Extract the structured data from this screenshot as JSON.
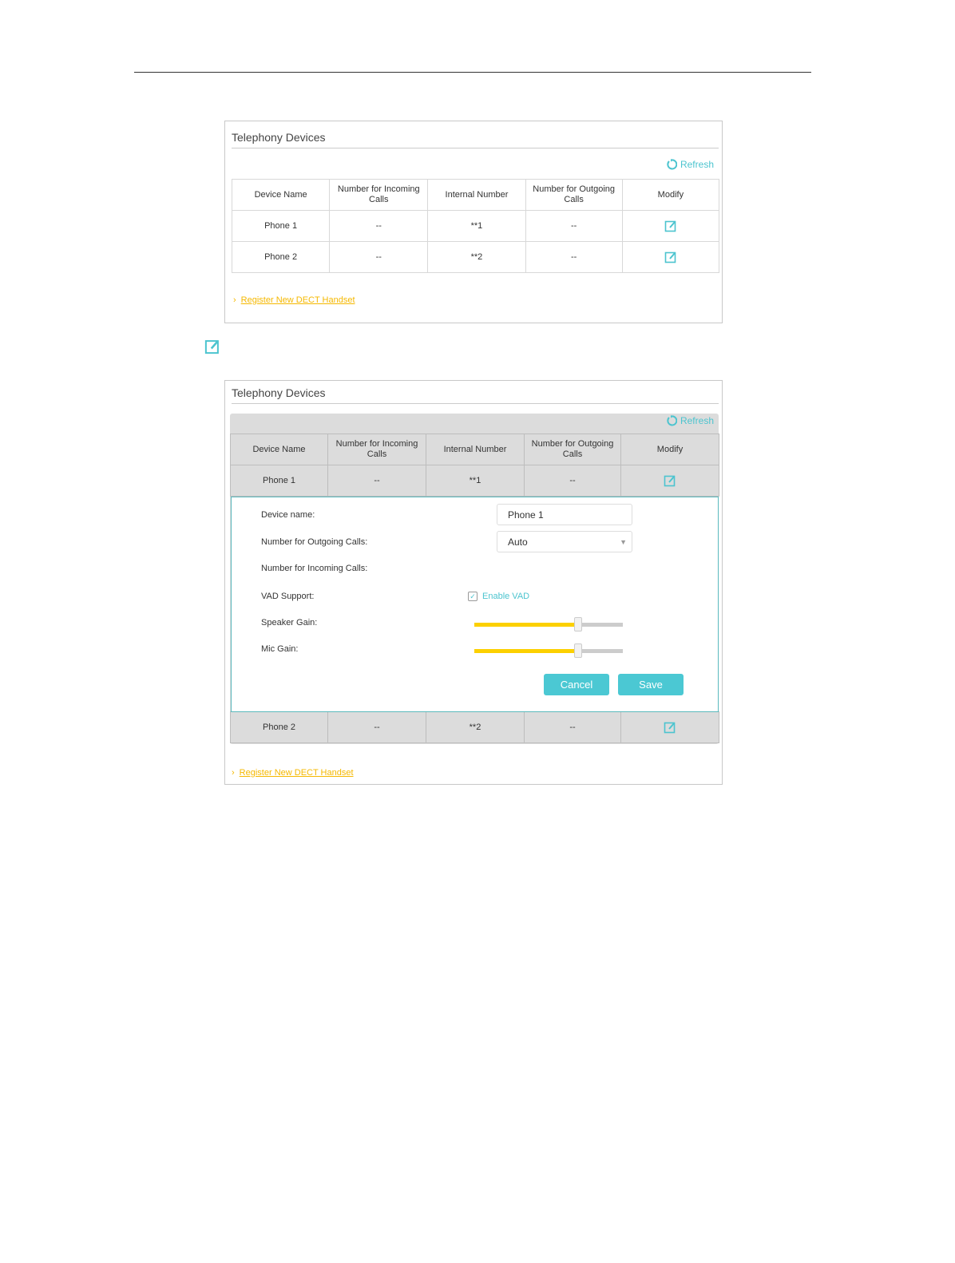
{
  "panel_title": "Telephony Devices",
  "refresh_label": "Refresh",
  "columns": [
    "Device Name",
    "Number for Incoming Calls",
    "Internal Number",
    "Number for Outgoing Calls",
    "Modify"
  ],
  "rows": [
    {
      "name": "Phone 1",
      "incoming": "--",
      "internal": "**1",
      "outgoing": "--"
    },
    {
      "name": "Phone 2",
      "incoming": "--",
      "internal": "**2",
      "outgoing": "--"
    }
  ],
  "register_link": "Register New DECT Handset",
  "form": {
    "device_name_label": "Device name:",
    "device_name_value": "Phone 1",
    "outgoing_label": "Number for Outgoing Calls:",
    "outgoing_value": "Auto",
    "incoming_label": "Number for Incoming Calls:",
    "vad_label": "VAD Support:",
    "vad_option": "Enable VAD",
    "vad_checked": true,
    "speaker_label": "Speaker Gain:",
    "speaker_gain_percent": 70,
    "mic_label": "Mic Gain:",
    "mic_gain_percent": 70,
    "cancel": "Cancel",
    "save": "Save"
  },
  "colors": {
    "accent": "#4bc8d3",
    "link": "#f5b800",
    "slider_fill": "#fcd000"
  }
}
